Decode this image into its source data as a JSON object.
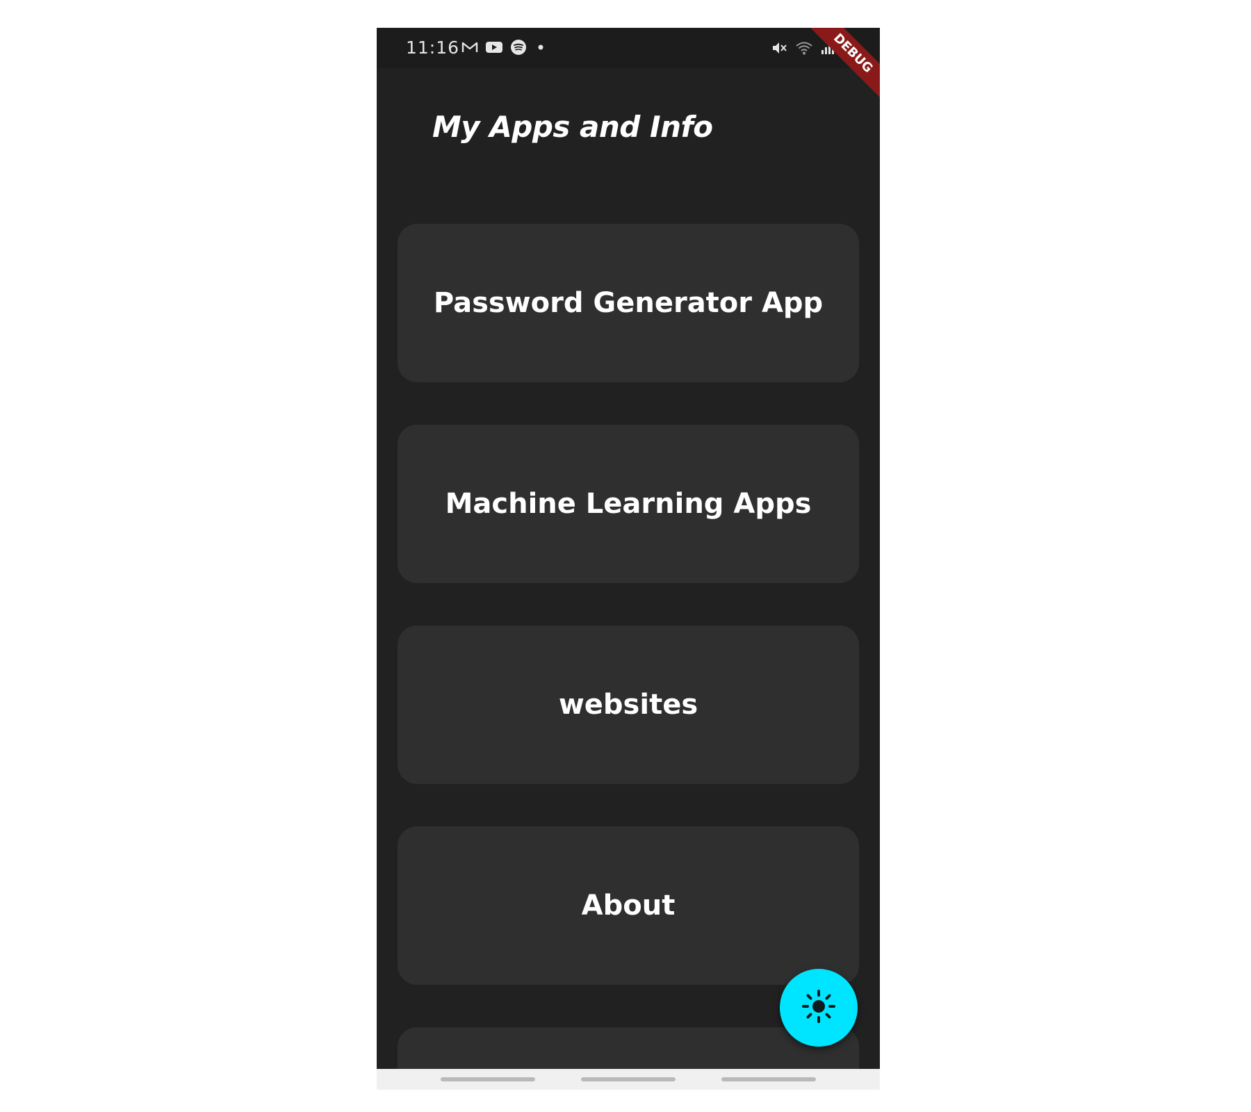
{
  "status_bar": {
    "time": "11:16",
    "left_icons": [
      "gmail-icon",
      "youtube-icon",
      "spotify-icon",
      "dot-icon"
    ],
    "right_icons": [
      "mute-icon",
      "wifi-icon",
      "signal-icon",
      "battery-icon"
    ]
  },
  "debug_banner": "DEBUG",
  "app_bar": {
    "title": "My Apps and Info"
  },
  "menu": {
    "items": [
      {
        "label": "Password Generator App"
      },
      {
        "label": "Machine Learning Apps"
      },
      {
        "label": "websites"
      },
      {
        "label": "About"
      }
    ]
  },
  "fab": {
    "icon": "brightness-icon",
    "color": "#00e5ff"
  },
  "colors": {
    "background": "#212121",
    "card": "#2f2f2f",
    "accent": "#00e5ff",
    "debug_banner": "#8a1a1a"
  }
}
